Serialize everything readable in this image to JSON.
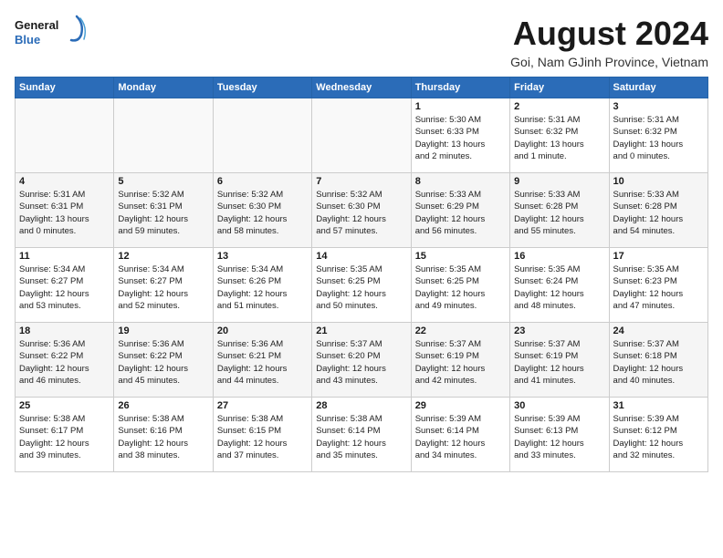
{
  "header": {
    "logo_line1": "General",
    "logo_line2": "Blue",
    "main_title": "August 2024",
    "subtitle": "Goi, Nam GJinh Province, Vietnam"
  },
  "days_of_week": [
    "Sunday",
    "Monday",
    "Tuesday",
    "Wednesday",
    "Thursday",
    "Friday",
    "Saturday"
  ],
  "weeks": [
    [
      {
        "day": "",
        "info": ""
      },
      {
        "day": "",
        "info": ""
      },
      {
        "day": "",
        "info": ""
      },
      {
        "day": "",
        "info": ""
      },
      {
        "day": "1",
        "info": "Sunrise: 5:30 AM\nSunset: 6:33 PM\nDaylight: 13 hours\nand 2 minutes."
      },
      {
        "day": "2",
        "info": "Sunrise: 5:31 AM\nSunset: 6:32 PM\nDaylight: 13 hours\nand 1 minute."
      },
      {
        "day": "3",
        "info": "Sunrise: 5:31 AM\nSunset: 6:32 PM\nDaylight: 13 hours\nand 0 minutes."
      }
    ],
    [
      {
        "day": "4",
        "info": "Sunrise: 5:31 AM\nSunset: 6:31 PM\nDaylight: 13 hours\nand 0 minutes."
      },
      {
        "day": "5",
        "info": "Sunrise: 5:32 AM\nSunset: 6:31 PM\nDaylight: 12 hours\nand 59 minutes."
      },
      {
        "day": "6",
        "info": "Sunrise: 5:32 AM\nSunset: 6:30 PM\nDaylight: 12 hours\nand 58 minutes."
      },
      {
        "day": "7",
        "info": "Sunrise: 5:32 AM\nSunset: 6:30 PM\nDaylight: 12 hours\nand 57 minutes."
      },
      {
        "day": "8",
        "info": "Sunrise: 5:33 AM\nSunset: 6:29 PM\nDaylight: 12 hours\nand 56 minutes."
      },
      {
        "day": "9",
        "info": "Sunrise: 5:33 AM\nSunset: 6:28 PM\nDaylight: 12 hours\nand 55 minutes."
      },
      {
        "day": "10",
        "info": "Sunrise: 5:33 AM\nSunset: 6:28 PM\nDaylight: 12 hours\nand 54 minutes."
      }
    ],
    [
      {
        "day": "11",
        "info": "Sunrise: 5:34 AM\nSunset: 6:27 PM\nDaylight: 12 hours\nand 53 minutes."
      },
      {
        "day": "12",
        "info": "Sunrise: 5:34 AM\nSunset: 6:27 PM\nDaylight: 12 hours\nand 52 minutes."
      },
      {
        "day": "13",
        "info": "Sunrise: 5:34 AM\nSunset: 6:26 PM\nDaylight: 12 hours\nand 51 minutes."
      },
      {
        "day": "14",
        "info": "Sunrise: 5:35 AM\nSunset: 6:25 PM\nDaylight: 12 hours\nand 50 minutes."
      },
      {
        "day": "15",
        "info": "Sunrise: 5:35 AM\nSunset: 6:25 PM\nDaylight: 12 hours\nand 49 minutes."
      },
      {
        "day": "16",
        "info": "Sunrise: 5:35 AM\nSunset: 6:24 PM\nDaylight: 12 hours\nand 48 minutes."
      },
      {
        "day": "17",
        "info": "Sunrise: 5:35 AM\nSunset: 6:23 PM\nDaylight: 12 hours\nand 47 minutes."
      }
    ],
    [
      {
        "day": "18",
        "info": "Sunrise: 5:36 AM\nSunset: 6:22 PM\nDaylight: 12 hours\nand 46 minutes."
      },
      {
        "day": "19",
        "info": "Sunrise: 5:36 AM\nSunset: 6:22 PM\nDaylight: 12 hours\nand 45 minutes."
      },
      {
        "day": "20",
        "info": "Sunrise: 5:36 AM\nSunset: 6:21 PM\nDaylight: 12 hours\nand 44 minutes."
      },
      {
        "day": "21",
        "info": "Sunrise: 5:37 AM\nSunset: 6:20 PM\nDaylight: 12 hours\nand 43 minutes."
      },
      {
        "day": "22",
        "info": "Sunrise: 5:37 AM\nSunset: 6:19 PM\nDaylight: 12 hours\nand 42 minutes."
      },
      {
        "day": "23",
        "info": "Sunrise: 5:37 AM\nSunset: 6:19 PM\nDaylight: 12 hours\nand 41 minutes."
      },
      {
        "day": "24",
        "info": "Sunrise: 5:37 AM\nSunset: 6:18 PM\nDaylight: 12 hours\nand 40 minutes."
      }
    ],
    [
      {
        "day": "25",
        "info": "Sunrise: 5:38 AM\nSunset: 6:17 PM\nDaylight: 12 hours\nand 39 minutes."
      },
      {
        "day": "26",
        "info": "Sunrise: 5:38 AM\nSunset: 6:16 PM\nDaylight: 12 hours\nand 38 minutes."
      },
      {
        "day": "27",
        "info": "Sunrise: 5:38 AM\nSunset: 6:15 PM\nDaylight: 12 hours\nand 37 minutes."
      },
      {
        "day": "28",
        "info": "Sunrise: 5:38 AM\nSunset: 6:14 PM\nDaylight: 12 hours\nand 35 minutes."
      },
      {
        "day": "29",
        "info": "Sunrise: 5:39 AM\nSunset: 6:14 PM\nDaylight: 12 hours\nand 34 minutes."
      },
      {
        "day": "30",
        "info": "Sunrise: 5:39 AM\nSunset: 6:13 PM\nDaylight: 12 hours\nand 33 minutes."
      },
      {
        "day": "31",
        "info": "Sunrise: 5:39 AM\nSunset: 6:12 PM\nDaylight: 12 hours\nand 32 minutes."
      }
    ]
  ]
}
